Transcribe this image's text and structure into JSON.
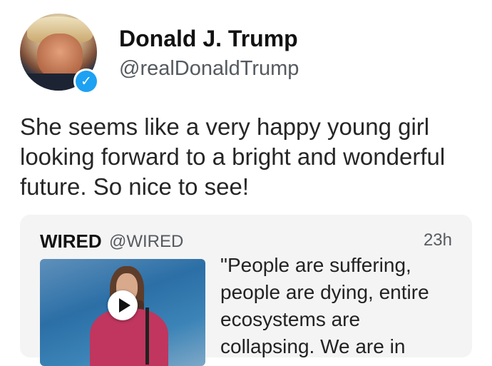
{
  "author": {
    "display_name": "Donald J. Trump",
    "handle": "@realDonaldTrump",
    "avatar_icon": "profile-photo",
    "verified_icon": "verified-check-icon",
    "verified_color": "#1da1f2"
  },
  "tweet": {
    "text": "She seems like a very happy young girl looking forward to a bright and wonderful future. So nice to see!"
  },
  "quoted_tweet": {
    "author_name": "WIRED",
    "handle": "@WIRED",
    "time": "23h",
    "text": "\"People are suffering, people are dying, entire ecosystems are collapsing. We are in",
    "media_icon": "video-thumbnail",
    "play_icon": "play-icon"
  }
}
